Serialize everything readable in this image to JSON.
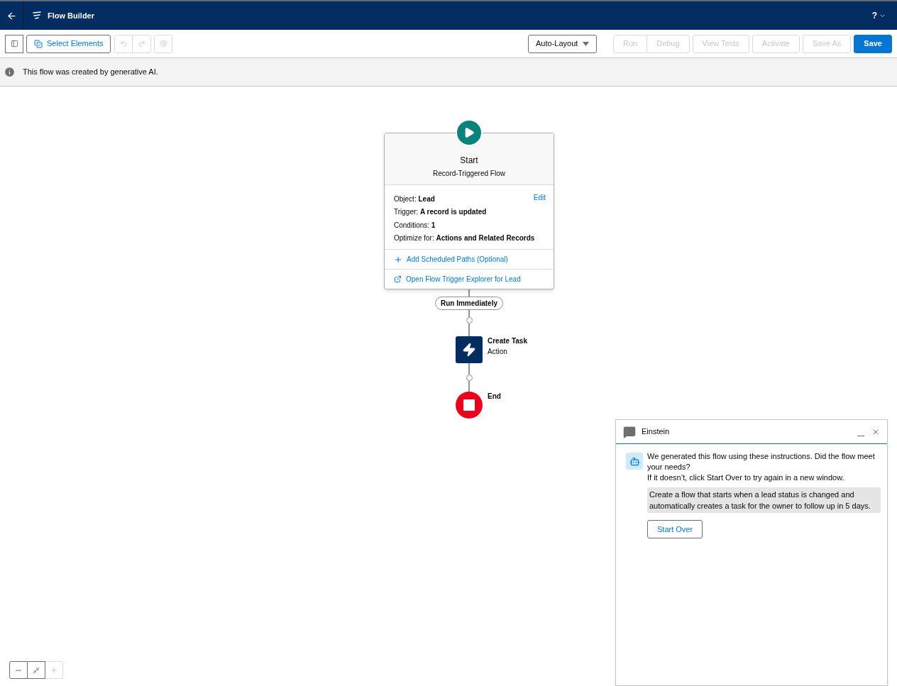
{
  "header": {
    "title": "Flow Builder",
    "help": "?"
  },
  "toolbar": {
    "select_button": "Select Elements",
    "undo_disabled": true,
    "redo_disabled": true,
    "settings_disabled": true,
    "layout_dropdown": "Auto-Layout",
    "buttons": [
      {
        "label": "Run",
        "disabled": true,
        "kind": "grouped"
      },
      {
        "label": "Debug",
        "disabled": true,
        "kind": "grouped"
      },
      {
        "label": "View Tests",
        "disabled": true,
        "kind": "plain"
      },
      {
        "label": "Activate",
        "disabled": true,
        "kind": "plain"
      },
      {
        "label": "Save As",
        "disabled": true,
        "kind": "plain"
      },
      {
        "label": "Save",
        "disabled": false,
        "kind": "primary"
      }
    ]
  },
  "banner": "This flow was created by generative AI.",
  "start": {
    "title": "Start",
    "subtitle": "Record-Triggered Flow",
    "edit": "Edit",
    "fields": [
      {
        "label": "Object:",
        "value": "Lead"
      },
      {
        "label": "Trigger:",
        "value": "A record is updated"
      },
      {
        "label": "Conditions:",
        "value": "1"
      },
      {
        "label": "Optimize for:",
        "value": "Actions and Related Records"
      }
    ],
    "links": [
      {
        "kind": "add",
        "label": "Add Scheduled Paths (Optional)"
      },
      {
        "kind": "external",
        "label": "Open Flow Trigger Explorer for Lead"
      }
    ]
  },
  "path_label": "Run Immediately",
  "nodes": [
    {
      "kind": "action",
      "title": "Create Task",
      "subtitle": "Action"
    },
    {
      "kind": "end",
      "title": "End"
    }
  ],
  "einstein": {
    "title": "Einstein",
    "messages": [
      "We generated this flow using these instructions. Did the flow meet your needs?",
      "If it doesn’t, click Start Over to try again in a new window."
    ],
    "prompt": "Create a flow that starts when a lead status is changed and automatically creates a task for the owner to follow up in 5 days.",
    "button": "Start Over"
  },
  "zoom": {
    "zoom_out_disabled": false,
    "fit_disabled": false,
    "zoom_in_disabled": true
  }
}
